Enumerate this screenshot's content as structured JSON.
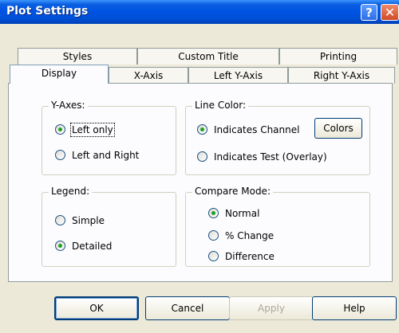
{
  "window": {
    "title": "Plot Settings"
  },
  "titlebar": {
    "help_glyph": "?",
    "close_glyph": "✕"
  },
  "tabs_back": [
    {
      "label": "Styles"
    },
    {
      "label": "Custom Title"
    },
    {
      "label": "Printing"
    }
  ],
  "tabs_front": [
    {
      "label": "Display",
      "active": true
    },
    {
      "label": "X-Axis"
    },
    {
      "label": "Left Y-Axis"
    },
    {
      "label": "Right Y-Axis"
    }
  ],
  "y_axes": {
    "title": "Y-Axes:",
    "options": [
      {
        "label": "Left only",
        "selected": true
      },
      {
        "label": "Left and Right",
        "selected": false
      }
    ]
  },
  "line_color": {
    "title": "Line Color:",
    "options": [
      {
        "label": "Indicates Channel",
        "selected": true
      },
      {
        "label": "Indicates Test (Overlay)",
        "selected": false
      }
    ],
    "colors_button": "Colors"
  },
  "legend": {
    "title": "Legend:",
    "options": [
      {
        "label": "Simple",
        "selected": false
      },
      {
        "label": "Detailed",
        "selected": true
      }
    ]
  },
  "compare_mode": {
    "title": "Compare Mode:",
    "options": [
      {
        "label": "Normal",
        "selected": true
      },
      {
        "label": "% Change",
        "selected": false
      },
      {
        "label": "Difference",
        "selected": false
      }
    ]
  },
  "buttons": {
    "ok": "OK",
    "cancel": "Cancel",
    "apply": "Apply",
    "help": "Help"
  }
}
